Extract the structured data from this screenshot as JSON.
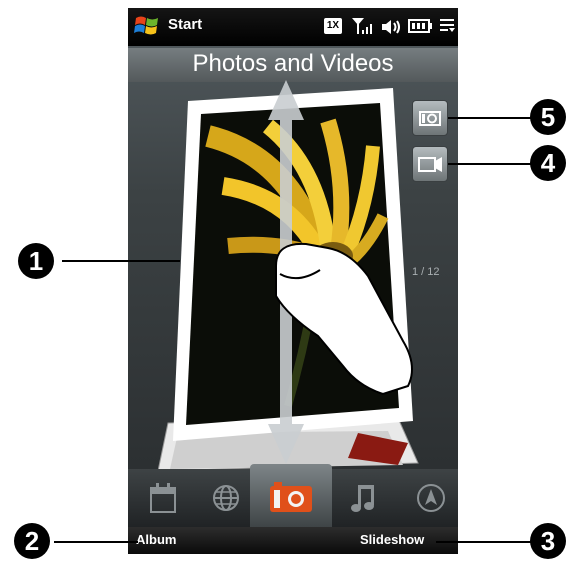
{
  "statusbar": {
    "start_label": "Start",
    "network_label": "1X",
    "icons": [
      "windows-logo-icon",
      "network-1x-icon",
      "signal-icon",
      "volume-icon",
      "battery-icon",
      "menu-icon"
    ]
  },
  "panel": {
    "title": "Photos and Videos",
    "photo_counter": "1 / 12",
    "side_buttons": [
      "camera-icon",
      "video-camera-icon"
    ],
    "gesture": "swipe-up-down"
  },
  "tabs": [
    {
      "name": "calendar",
      "icon": "calendar-icon"
    },
    {
      "name": "internet",
      "icon": "globe-icon"
    },
    {
      "name": "photos-videos",
      "icon": "camera-icon",
      "active": true
    },
    {
      "name": "music",
      "icon": "music-note-icon"
    },
    {
      "name": "settings",
      "icon": "compass-icon"
    }
  ],
  "softkeys": {
    "left": "Album",
    "right": "Slideshow"
  },
  "callouts": [
    "1",
    "2",
    "3",
    "4",
    "5"
  ],
  "colors": {
    "active_tab_accent": "#e0501a",
    "photo_yellow": "#f0c420",
    "panel_background": "#3c4244"
  }
}
